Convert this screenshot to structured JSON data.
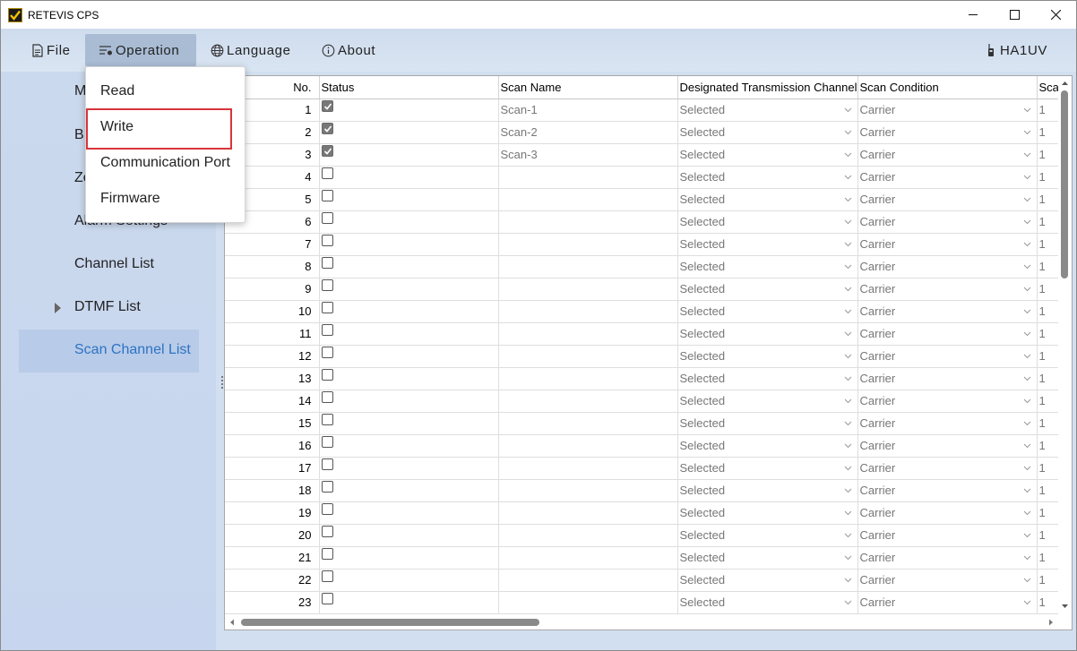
{
  "window": {
    "title": "RETEVIS CPS"
  },
  "menubar": {
    "file": "File",
    "operation": "Operation",
    "language": "Language",
    "about": "About",
    "user": "HA1UV"
  },
  "operation_menu": {
    "items": [
      "Read",
      "Write",
      "Communication Port",
      "Firmware"
    ],
    "highlighted": "Write"
  },
  "sidebar": {
    "partial_items": [
      "M",
      "B",
      "Zo",
      "Alarm Settings"
    ],
    "channel_list": "Channel List",
    "dtmf_list": "DTMF List",
    "scan_channel_list": "Scan Channel List",
    "selected": "Scan Channel List"
  },
  "table": {
    "headers": [
      "No.",
      "Status",
      "Scan Name",
      "Designated Transmission Channel",
      "Scan Condition",
      "Scan"
    ],
    "rows": [
      {
        "no": "1",
        "status": true,
        "name": "Scan-1",
        "channel": "Selected",
        "condition": "Carrier",
        "scan": "1"
      },
      {
        "no": "2",
        "status": true,
        "name": "Scan-2",
        "channel": "Selected",
        "condition": "Carrier",
        "scan": "1"
      },
      {
        "no": "3",
        "status": true,
        "name": "Scan-3",
        "channel": "Selected",
        "condition": "Carrier",
        "scan": "1"
      },
      {
        "no": "4",
        "status": false,
        "name": "",
        "channel": "Selected",
        "condition": "Carrier",
        "scan": "1"
      },
      {
        "no": "5",
        "status": false,
        "name": "",
        "channel": "Selected",
        "condition": "Carrier",
        "scan": "1"
      },
      {
        "no": "6",
        "status": false,
        "name": "",
        "channel": "Selected",
        "condition": "Carrier",
        "scan": "1"
      },
      {
        "no": "7",
        "status": false,
        "name": "",
        "channel": "Selected",
        "condition": "Carrier",
        "scan": "1"
      },
      {
        "no": "8",
        "status": false,
        "name": "",
        "channel": "Selected",
        "condition": "Carrier",
        "scan": "1"
      },
      {
        "no": "9",
        "status": false,
        "name": "",
        "channel": "Selected",
        "condition": "Carrier",
        "scan": "1"
      },
      {
        "no": "10",
        "status": false,
        "name": "",
        "channel": "Selected",
        "condition": "Carrier",
        "scan": "1"
      },
      {
        "no": "11",
        "status": false,
        "name": "",
        "channel": "Selected",
        "condition": "Carrier",
        "scan": "1"
      },
      {
        "no": "12",
        "status": false,
        "name": "",
        "channel": "Selected",
        "condition": "Carrier",
        "scan": "1"
      },
      {
        "no": "13",
        "status": false,
        "name": "",
        "channel": "Selected",
        "condition": "Carrier",
        "scan": "1"
      },
      {
        "no": "14",
        "status": false,
        "name": "",
        "channel": "Selected",
        "condition": "Carrier",
        "scan": "1"
      },
      {
        "no": "15",
        "status": false,
        "name": "",
        "channel": "Selected",
        "condition": "Carrier",
        "scan": "1"
      },
      {
        "no": "16",
        "status": false,
        "name": "",
        "channel": "Selected",
        "condition": "Carrier",
        "scan": "1"
      },
      {
        "no": "17",
        "status": false,
        "name": "",
        "channel": "Selected",
        "condition": "Carrier",
        "scan": "1"
      },
      {
        "no": "18",
        "status": false,
        "name": "",
        "channel": "Selected",
        "condition": "Carrier",
        "scan": "1"
      },
      {
        "no": "19",
        "status": false,
        "name": "",
        "channel": "Selected",
        "condition": "Carrier",
        "scan": "1"
      },
      {
        "no": "20",
        "status": false,
        "name": "",
        "channel": "Selected",
        "condition": "Carrier",
        "scan": "1"
      },
      {
        "no": "21",
        "status": false,
        "name": "",
        "channel": "Selected",
        "condition": "Carrier",
        "scan": "1"
      },
      {
        "no": "22",
        "status": false,
        "name": "",
        "channel": "Selected",
        "condition": "Carrier",
        "scan": "1"
      },
      {
        "no": "23",
        "status": false,
        "name": "",
        "channel": "Selected",
        "condition": "Carrier",
        "scan": "1"
      }
    ]
  },
  "colors": {
    "menubar_bg": "#cfdcee",
    "sidebar_bg": "#cbd9ee",
    "selected_text": "#2d73c4",
    "highlight_border": "#d9343b"
  }
}
